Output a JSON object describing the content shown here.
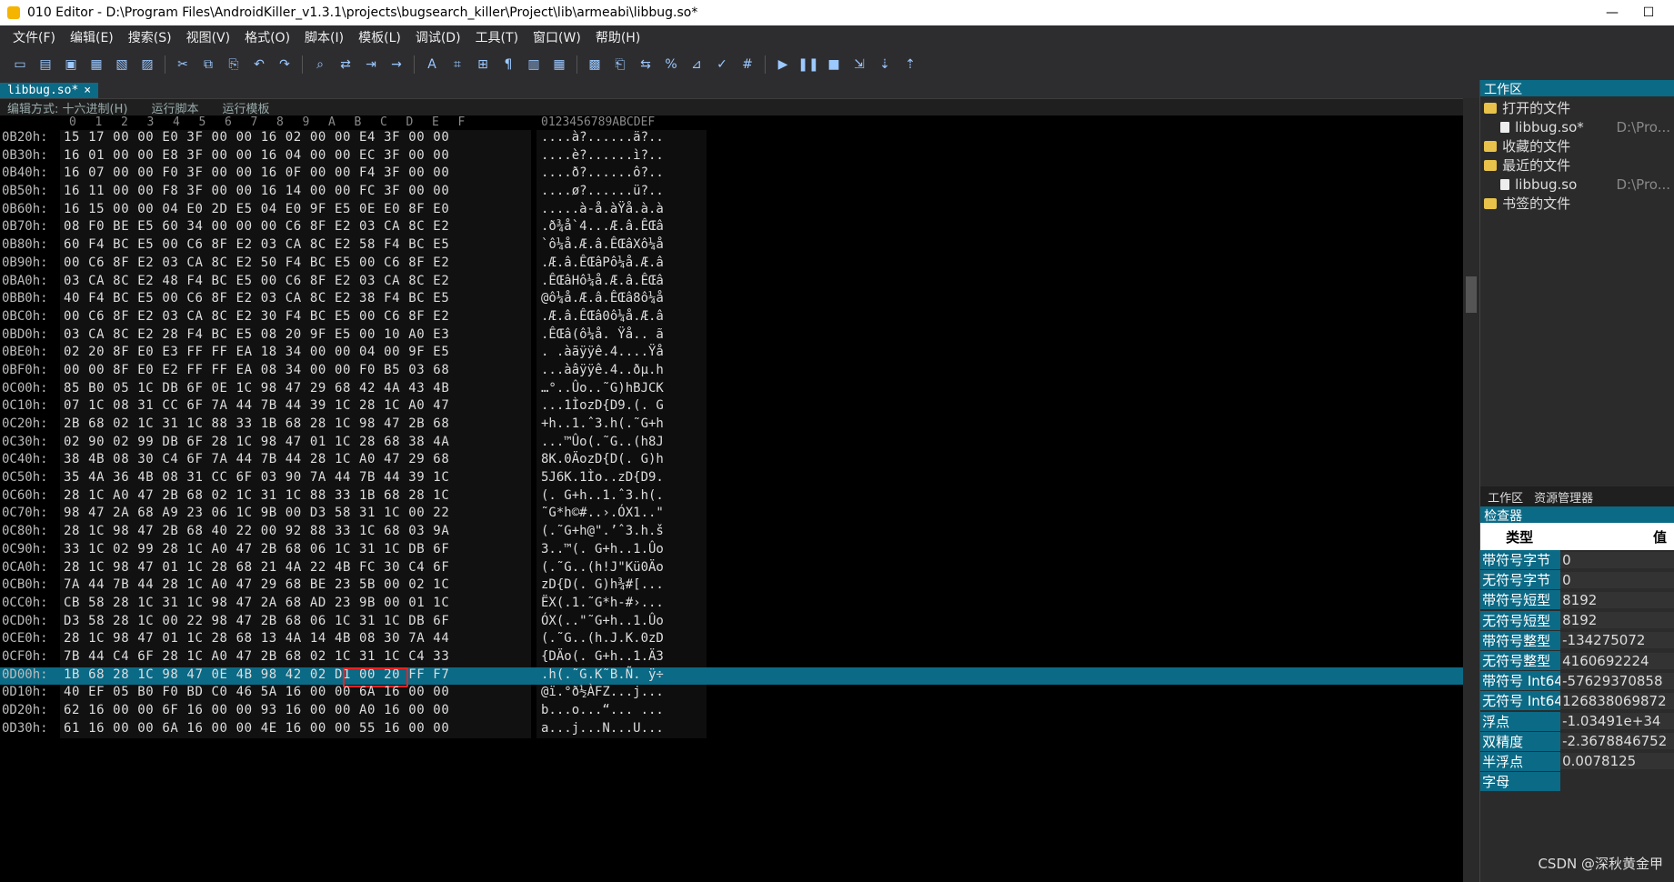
{
  "window": {
    "title": "010 Editor - D:\\Program Files\\AndroidKiller_v1.3.1\\projects\\bugsearch_killer\\Project\\lib\\armeabi\\libbug.so*",
    "min": "—",
    "max": "☐"
  },
  "menu": [
    "文件(F)",
    "编辑(E)",
    "搜索(S)",
    "视图(V)",
    "格式(O)",
    "脚本(I)",
    "模板(L)",
    "调试(D)",
    "工具(T)",
    "窗口(W)",
    "帮助(H)"
  ],
  "toolbar_icons": [
    "new-icon",
    "open-icon",
    "save-icon",
    "save-all-icon",
    "close-icon",
    "folder-icon",
    "cut-icon",
    "copy-icon",
    "paste-icon",
    "undo-icon",
    "redo-icon",
    "find-icon",
    "replace-icon",
    "goto-icon",
    "arrow-icon",
    "font-icon",
    "hex-icon",
    "compare-icon",
    "pilcrow-icon",
    "columns-icon",
    "grid-icon",
    "calc-icon",
    "clip-icon",
    "swap-icon",
    "percent-icon",
    "chart-icon",
    "check-icon",
    "hash-icon",
    "play-icon",
    "pause-icon",
    "stop-icon",
    "step-icon",
    "step-in-icon",
    "step-out-icon"
  ],
  "tab": {
    "label": "libbug.so*",
    "close": "×"
  },
  "subbar": {
    "encoding": "编辑方式: 十六进制(H)",
    "script": "运行脚本",
    "template": "运行模板"
  },
  "columns": {
    "hex": [
      "0",
      "1",
      "2",
      "3",
      "4",
      "5",
      "6",
      "7",
      "8",
      "9",
      "A",
      "B",
      "C",
      "D",
      "E",
      "F"
    ],
    "ascii": "0123456789ABCDEF"
  },
  "rows": [
    {
      "off": "0B20h:",
      "hex": "15 17 00 00 E0 3F 00 00 16 02 00 00 E4 3F 00 00",
      "asc": "....à?......ä?.."
    },
    {
      "off": "0B30h:",
      "hex": "16 01 00 00 E8 3F 00 00 16 04 00 00 EC 3F 00 00",
      "asc": "....è?......ì?.."
    },
    {
      "off": "0B40h:",
      "hex": "16 07 00 00 F0 3F 00 00 16 0F 00 00 F4 3F 00 00",
      "asc": "....ð?......ô?.."
    },
    {
      "off": "0B50h:",
      "hex": "16 11 00 00 F8 3F 00 00 16 14 00 00 FC 3F 00 00",
      "asc": "....ø?......ü?.."
    },
    {
      "off": "0B60h:",
      "hex": "16 15 00 00 04 E0 2D E5 04 E0 9F E5 0E E0 8F E0",
      "asc": ".....à-å.àŸå.à.à"
    },
    {
      "off": "0B70h:",
      "hex": "08 F0 BE E5 60 34 00 00 00 C6 8F E2 03 CA 8C E2",
      "asc": ".ð¾å`4...Æ.â.ÊŒâ"
    },
    {
      "off": "0B80h:",
      "hex": "60 F4 BC E5 00 C6 8F E2 03 CA 8C E2 58 F4 BC E5",
      "asc": "`ô¼å.Æ.â.ÊŒâXô¼å"
    },
    {
      "off": "0B90h:",
      "hex": "00 C6 8F E2 03 CA 8C E2 50 F4 BC E5 00 C6 8F E2",
      "asc": ".Æ.â.ÊŒâPô¼å.Æ.â"
    },
    {
      "off": "0BA0h:",
      "hex": "03 CA 8C E2 48 F4 BC E5 00 C6 8F E2 03 CA 8C E2",
      "asc": ".ÊŒâHô¼å.Æ.â.ÊŒâ"
    },
    {
      "off": "0BB0h:",
      "hex": "40 F4 BC E5 00 C6 8F E2 03 CA 8C E2 38 F4 BC E5",
      "asc": "@ô¼å.Æ.â.ÊŒâ8ô¼å"
    },
    {
      "off": "0BC0h:",
      "hex": "00 C6 8F E2 03 CA 8C E2 30 F4 BC E5 00 C6 8F E2",
      "asc": ".Æ.â.ÊŒâ0ô¼å.Æ.â"
    },
    {
      "off": "0BD0h:",
      "hex": "03 CA 8C E2 28 F4 BC E5 08 20 9F E5 00 10 A0 E3",
      "asc": ".ÊŒâ(ô¼å. Ÿå.. ã"
    },
    {
      "off": "0BE0h:",
      "hex": "02 20 8F E0 E3 FF FF EA 18 34 00 00 04 00 9F E5",
      "asc": ". .àãÿÿê.4....Ÿå"
    },
    {
      "off": "0BF0h:",
      "hex": "00 00 8F E0 E2 FF FF EA 08 34 00 00 F0 B5 03 68",
      "asc": "...àâÿÿê.4..ðµ.h"
    },
    {
      "off": "0C00h:",
      "hex": "85 B0 05 1C DB 6F 0E 1C 98 47 29 68 42 4A 43 4B",
      "asc": "…°..Ûo..˜G)hBJCK"
    },
    {
      "off": "0C10h:",
      "hex": "07 1C 08 31 CC 6F 7A 44 7B 44 39 1C 28 1C A0 47",
      "asc": "...1ÌozD{D9.(. G"
    },
    {
      "off": "0C20h:",
      "hex": "2B 68 02 1C 31 1C 88 33 1B 68 28 1C 98 47 2B 68",
      "asc": "+h..1.ˆ3.h(.˜G+h"
    },
    {
      "off": "0C30h:",
      "hex": "02 90 02 99 DB 6F 28 1C 98 47 01 1C 28 68 38 4A",
      "asc": "...™Ûo(.˜G..(h8J"
    },
    {
      "off": "0C40h:",
      "hex": "38 4B 08 30 C4 6F 7A 44 7B 44 28 1C A0 47 29 68",
      "asc": "8K.0ÄozD{D(. G)h"
    },
    {
      "off": "0C50h:",
      "hex": "35 4A 36 4B 08 31 CC 6F 03 90 7A 44 7B 44 39 1C",
      "asc": "5J6K.1Ìo..zD{D9."
    },
    {
      "off": "0C60h:",
      "hex": "28 1C A0 47 2B 68 02 1C 31 1C 88 33 1B 68 28 1C",
      "asc": "(. G+h..1.ˆ3.h(."
    },
    {
      "off": "0C70h:",
      "hex": "98 47 2A 68 A9 23 06 1C 9B 00 D3 58 31 1C 00 22",
      "asc": "˜G*h©#..›.ÓX1..\""
    },
    {
      "off": "0C80h:",
      "hex": "28 1C 98 47 2B 68 40 22 00 92 88 33 1C 68 03 9A",
      "asc": "(.˜G+h@\".’ˆ3.h.š"
    },
    {
      "off": "0C90h:",
      "hex": "33 1C 02 99 28 1C A0 47 2B 68 06 1C 31 1C DB 6F",
      "asc": "3..™(. G+h..1.Ûo"
    },
    {
      "off": "0CA0h:",
      "hex": "28 1C 98 47 01 1C 28 68 21 4A 22 4B FC 30 C4 6F",
      "asc": "(.˜G..(h!J\"Kü0Äo"
    },
    {
      "off": "0CB0h:",
      "hex": "7A 44 7B 44 28 1C A0 47 29 68 BE 23 5B 00 02 1C",
      "asc": "zD{D(. G)h¾#[..."
    },
    {
      "off": "0CC0h:",
      "hex": "CB 58 28 1C 31 1C 98 47 2A 68 AD 23 9B 00 01 1C",
      "asc": "ËX(.1.˜G*h-#›..."
    },
    {
      "off": "0CD0h:",
      "hex": "D3 58 28 1C 00 22 98 47 2B 68 06 1C 31 1C DB 6F",
      "asc": "ÓX(..\"˜G+h..1.Ûo"
    },
    {
      "off": "0CE0h:",
      "hex": "28 1C 98 47 01 1C 28 68 13 4A 14 4B 08 30 7A 44",
      "asc": "(.˜G..(h.J.K.0zD"
    },
    {
      "off": "0CF0h:",
      "hex": "7B 44 C4 6F 28 1C A0 47 2B 68 02 1C 31 1C C4 33",
      "asc": "{DÄo(. G+h..1.Ä3"
    },
    {
      "off": "0D00h:",
      "hex": "1B 68 28 1C 98 47 0E 4B 98 42 02 D1 00 20 FF F7",
      "asc": ".h(.˜G.K˜B.Ñ. ÿ÷",
      "highlight": true
    },
    {
      "off": "0D10h:",
      "hex": "40 EF 05 B0 F0 BD C0 46 5A 16 00 00 6A 16 00 00",
      "asc": "@ï.°ð½ÀFZ...j..."
    },
    {
      "off": "0D20h:",
      "hex": "62 16 00 00 6F 16 00 00 93 16 00 00 A0 16 00 00",
      "asc": "b...o...“... ..."
    },
    {
      "off": "0D30h:",
      "hex": "61 16 00 00 6A 16 00 00 4E 16 00 00 55 16 00 00",
      "asc": "a...j...N...U..."
    }
  ],
  "workspace": {
    "title": "工作区",
    "open_files": "打开的文件",
    "file1": "libbug.so*",
    "file1_path": "D:\\Pro...",
    "favorites": "收藏的文件",
    "recent": "最近的文件",
    "file2": "libbug.so",
    "file2_path": "D:\\Pro...",
    "bookmarks": "书签的文件"
  },
  "panel_tabs": {
    "workspace": "工作区",
    "explorer": "资源管理器"
  },
  "inspector": {
    "title": "检查器",
    "col_type": "类型",
    "col_value": "值",
    "rows": [
      {
        "k": "带符号字节",
        "v": "0"
      },
      {
        "k": "无符号字节",
        "v": "0"
      },
      {
        "k": "带符号短型",
        "v": "8192"
      },
      {
        "k": "无符号短型",
        "v": "8192"
      },
      {
        "k": "带符号整型",
        "v": "-134275072"
      },
      {
        "k": "无符号整型",
        "v": "4160692224"
      },
      {
        "k": "带符号 Int64",
        "v": "-57629370858"
      },
      {
        "k": "无符号 Int64",
        "v": "126838069872"
      },
      {
        "k": "浮点",
        "v": "-1.03491e+34"
      },
      {
        "k": "双精度",
        "v": "-2.3678846752"
      },
      {
        "k": "半浮点",
        "v": "0.0078125"
      },
      {
        "k": "字母",
        "v": ""
      }
    ]
  },
  "watermark": "CSDN @深秋黄金甲",
  "colors": {
    "accent": "#0b6a86",
    "selection_box": "#e22222"
  }
}
